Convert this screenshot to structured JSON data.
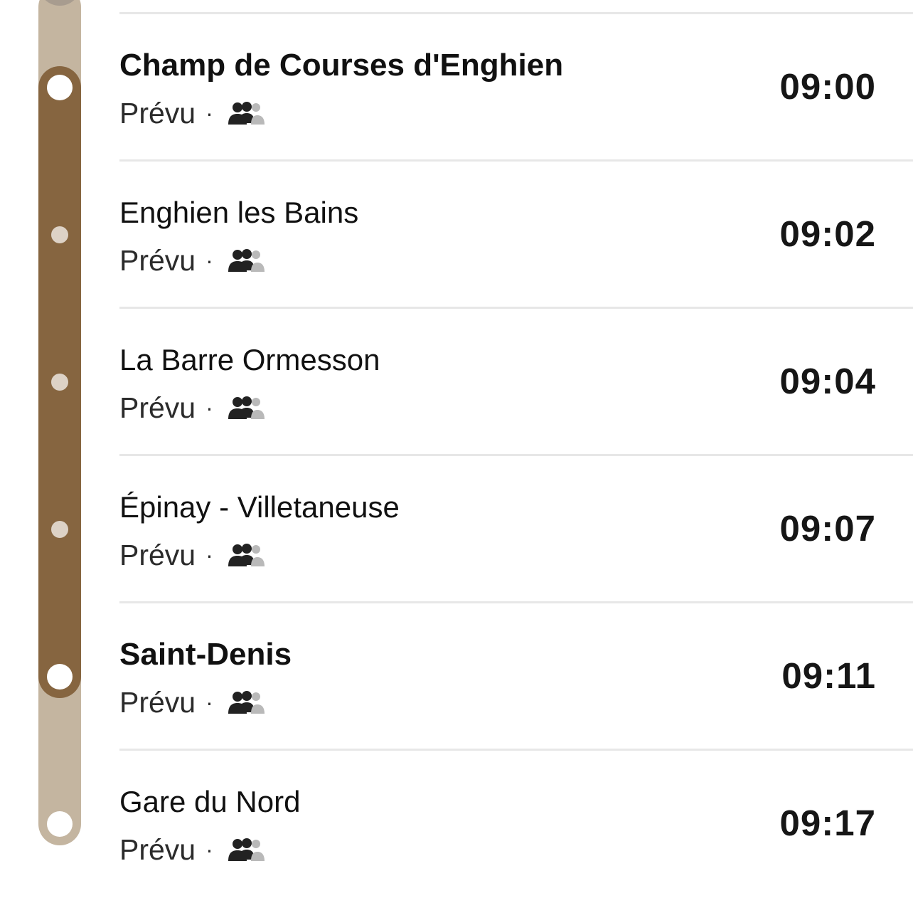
{
  "line_colors": {
    "active": "#866540",
    "inactive": "#c4b5a0"
  },
  "stops": [
    {
      "name": "Champ de Courses d'Enghien",
      "status": "Prévu",
      "separator": "·",
      "time": "09:00",
      "emphasis": true,
      "crowd_icon": "crowd-level-icon"
    },
    {
      "name": "Enghien les Bains",
      "status": "Prévu",
      "separator": "·",
      "time": "09:02",
      "emphasis": false,
      "crowd_icon": "crowd-level-icon"
    },
    {
      "name": "La Barre Ormesson",
      "status": "Prévu",
      "separator": "·",
      "time": "09:04",
      "emphasis": false,
      "crowd_icon": "crowd-level-icon"
    },
    {
      "name": "Épinay - Villetaneuse",
      "status": "Prévu",
      "separator": "·",
      "time": "09:07",
      "emphasis": false,
      "crowd_icon": "crowd-level-icon"
    },
    {
      "name": "Saint-Denis",
      "status": "Prévu",
      "separator": "·",
      "time": "09:11",
      "emphasis": true,
      "crowd_icon": "crowd-level-icon"
    },
    {
      "name": "Gare du Nord",
      "status": "Prévu",
      "separator": "·",
      "time": "09:17",
      "emphasis": false,
      "crowd_icon": "crowd-level-icon"
    }
  ]
}
